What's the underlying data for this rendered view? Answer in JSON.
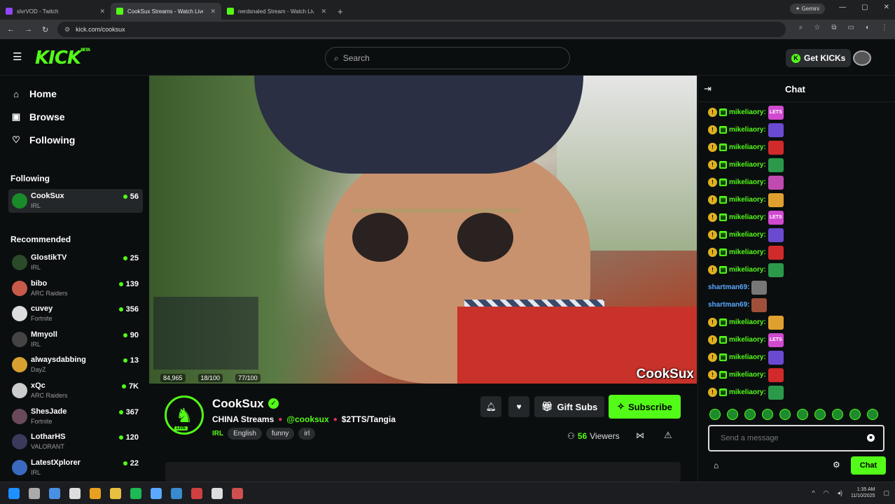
{
  "browser": {
    "tabs": [
      {
        "title": "slvrVOD - Twitch",
        "favicon_color": "#9146ff",
        "active": false
      },
      {
        "title": "CookSux Streams - Watch Live",
        "favicon_color": "#53fc18",
        "active": true
      },
      {
        "title": "nerdsnaled Stream - Watch Live",
        "favicon_color": "#53fc18",
        "active": false
      }
    ],
    "gemini_label": "Gemini",
    "url": "kick.com/cooksux"
  },
  "header": {
    "logo": "KICK",
    "logo_sup": "BETA",
    "search_placeholder": "Search",
    "get_kicks_label": "Get KICKs"
  },
  "sidebar": {
    "nav": [
      {
        "label": "Home",
        "icon": "home-icon"
      },
      {
        "label": "Browse",
        "icon": "browse-icon"
      },
      {
        "label": "Following",
        "icon": "heart-icon"
      }
    ],
    "following_heading": "Following",
    "following": [
      {
        "name": "CookSux",
        "category": "IRL",
        "viewers": "56",
        "color": "#1a8a2a"
      }
    ],
    "recommended_heading": "Recommended",
    "recommended": [
      {
        "name": "GlostikTV",
        "category": "IRL",
        "viewers": "25",
        "color": "#2a4a2a"
      },
      {
        "name": "bibo",
        "category": "ARC Raiders",
        "viewers": "139",
        "color": "#c85a4a"
      },
      {
        "name": "cuvey",
        "category": "Fortnite",
        "viewers": "356",
        "color": "#dddddd"
      },
      {
        "name": "Mmyoll",
        "category": "IRL",
        "viewers": "90",
        "color": "#444444"
      },
      {
        "name": "alwaysdabbing",
        "category": "DayZ",
        "viewers": "13",
        "color": "#d8a030"
      },
      {
        "name": "xQc",
        "category": "ARC Raiders",
        "viewers": "7K",
        "color": "#cccccc"
      },
      {
        "name": "ShesJade",
        "category": "Fortnite",
        "viewers": "367",
        "color": "#6a4a5a"
      },
      {
        "name": "LotharHS",
        "category": "VALORANT",
        "viewers": "120",
        "color": "#3a3a5a"
      },
      {
        "name": "LatestXplorer",
        "category": "IRL",
        "viewers": "22",
        "color": "#3a6ac0"
      }
    ]
  },
  "video": {
    "overlay_stats": [
      "84,965",
      "18/100",
      "77/100"
    ],
    "watermark": "CookSux"
  },
  "stream": {
    "channel_name": "CookSux",
    "live_badge": "LIVE",
    "title_parts": {
      "prefix": "CHINA Streams",
      "handle": "@cooksux",
      "suffix": "$2TTS/Tangia"
    },
    "category": "IRL",
    "tags": [
      "English",
      "funny",
      "irl"
    ],
    "gift_subs_label": "Gift Subs",
    "subscribe_label": "Subscribe",
    "viewer_count": "56",
    "viewers_label": "Viewers"
  },
  "chat": {
    "title": "Chat",
    "messages": [
      {
        "user": "mikeliaory:",
        "emote": "LETS",
        "emote_color": "#d04ad0",
        "badges": true
      },
      {
        "user": "mikeliaory:",
        "emote": "",
        "emote_color": "#6a4ad0",
        "badges": true
      },
      {
        "user": "mikeliaory:",
        "emote": "",
        "emote_color": "#d02a2a",
        "badges": true
      },
      {
        "user": "mikeliaory:",
        "emote": "",
        "emote_color": "#2a9a4a",
        "badges": true
      },
      {
        "user": "mikeliaory:",
        "emote": "",
        "emote_color": "#c04ab0",
        "badges": true
      },
      {
        "user": "mikeliaory:",
        "emote": "",
        "emote_color": "#e0a030",
        "badges": true
      },
      {
        "user": "mikeliaory:",
        "emote": "LETS",
        "emote_color": "#d04ad0",
        "badges": true
      },
      {
        "user": "mikeliaory:",
        "emote": "",
        "emote_color": "#6a4ad0",
        "badges": true
      },
      {
        "user": "mikeliaory:",
        "emote": "",
        "emote_color": "#d02a2a",
        "badges": true
      },
      {
        "user": "mikeliaory:",
        "emote": "",
        "emote_color": "#2a9a4a",
        "badges": true
      },
      {
        "user": "shartman69:",
        "emote": "",
        "emote_color": "#777777",
        "badges": false
      },
      {
        "user": "shartman69:",
        "emote": "",
        "emote_color": "#a0503a",
        "badges": false
      },
      {
        "user": "mikeliaory:",
        "emote": "",
        "emote_color": "#e0a030",
        "badges": true
      },
      {
        "user": "mikeliaory:",
        "emote": "LETS",
        "emote_color": "#d04ad0",
        "badges": true
      },
      {
        "user": "mikeliaory:",
        "emote": "",
        "emote_color": "#6a4ad0",
        "badges": true
      },
      {
        "user": "mikeliaory:",
        "emote": "",
        "emote_color": "#d02a2a",
        "badges": true
      },
      {
        "user": "mikeliaory:",
        "emote": "",
        "emote_color": "#2a9a4a",
        "badges": true
      }
    ],
    "input_placeholder": "Send a message",
    "send_label": "Chat"
  },
  "taskbar": {
    "icon_colors": [
      "#1e90ff",
      "#aaaaaa",
      "#4a90e2",
      "#dddddd",
      "#e8a020",
      "#e8c040",
      "#1db954",
      "#5aa8ff",
      "#3a8ad0",
      "#d04040",
      "#dddddd",
      "#d05050"
    ],
    "time": "1:35 AM",
    "date": "11/10/2025"
  },
  "colors": {
    "accent": "#53fc18",
    "background": "#0b0e0f"
  }
}
